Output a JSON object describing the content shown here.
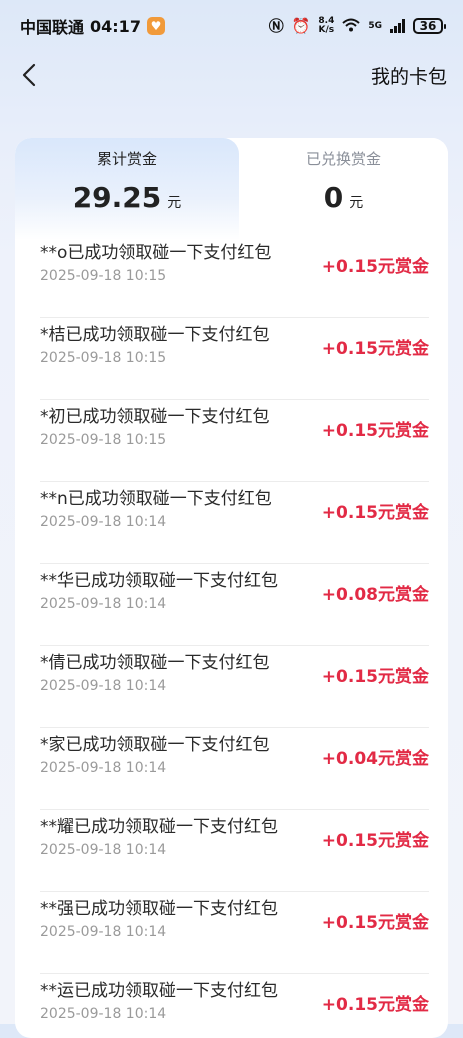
{
  "status_bar": {
    "carrier": "中国联通",
    "time": "04:17",
    "net_speed_value": "8.4",
    "net_speed_unit": "K/s",
    "network_type": "5G",
    "battery": "36"
  },
  "header": {
    "title": "我的卡包"
  },
  "tabs": [
    {
      "label": "累计赏金",
      "amount": "29.25",
      "unit": "元"
    },
    {
      "label": "已兑换赏金",
      "amount": "0",
      "unit": "元"
    }
  ],
  "records": [
    {
      "title": "**o已成功领取碰一下支付红包",
      "time": "2025-09-18 10:15",
      "amount": "+0.15元赏金"
    },
    {
      "title": "*桔已成功领取碰一下支付红包",
      "time": "2025-09-18 10:15",
      "amount": "+0.15元赏金"
    },
    {
      "title": "*初已成功领取碰一下支付红包",
      "time": "2025-09-18 10:15",
      "amount": "+0.15元赏金"
    },
    {
      "title": "**n已成功领取碰一下支付红包",
      "time": "2025-09-18 10:14",
      "amount": "+0.15元赏金"
    },
    {
      "title": "**华已成功领取碰一下支付红包",
      "time": "2025-09-18 10:14",
      "amount": "+0.08元赏金"
    },
    {
      "title": "*倩已成功领取碰一下支付红包",
      "time": "2025-09-18 10:14",
      "amount": "+0.15元赏金"
    },
    {
      "title": "*家已成功领取碰一下支付红包",
      "time": "2025-09-18 10:14",
      "amount": "+0.04元赏金"
    },
    {
      "title": "**耀已成功领取碰一下支付红包",
      "time": "2025-09-18 10:14",
      "amount": "+0.15元赏金"
    },
    {
      "title": "**强已成功领取碰一下支付红包",
      "time": "2025-09-18 10:14",
      "amount": "+0.15元赏金"
    },
    {
      "title": "**运已成功领取碰一下支付红包",
      "time": "2025-09-18 10:14",
      "amount": "+0.15元赏金"
    }
  ],
  "colors": {
    "accent_red": "#e22a45",
    "tab_active_bg": "#d9e7fb",
    "page_bg": "#e8eefa"
  }
}
